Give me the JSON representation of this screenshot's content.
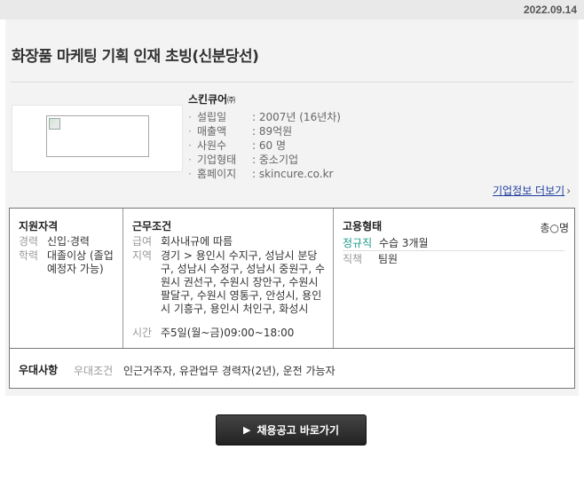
{
  "header": {
    "date": "2022.09.14"
  },
  "job": {
    "title": "화장품 마케팅 기획 인재 초빙(신분당선)"
  },
  "company": {
    "name": "스킨큐어",
    "name_suffix": "㈜",
    "info": [
      {
        "label": "설립일",
        "value": ": 2007년 (16년차)"
      },
      {
        "label": "매출액",
        "value": ": 89억원"
      },
      {
        "label": "사원수",
        "value": ": 60 명"
      },
      {
        "label": "기업형태",
        "value": ": 중소기업"
      },
      {
        "label": "홈페이지",
        "value": ": skincure.co.kr"
      }
    ],
    "more_link": "기업정보 더보기"
  },
  "qualification": {
    "title": "지원자격",
    "career_label": "경력",
    "career_value": "신입·경력",
    "education_label": "학력",
    "education_value": "대졸이상 (졸업예정자 가능)"
  },
  "work": {
    "title": "근무조건",
    "salary_label": "급여",
    "salary_value": "회사내규에 따름",
    "region_label": "지역",
    "region_value": "경기 > 용인시 수지구, 성남시 분당구, 성남시 수정구, 성남시 중원구, 수원시 권선구, 수원시 장안구, 수원시 팔달구, 수원시 영통구, 안성시, 용인시 기흥구, 용인시 처인구, 화성시",
    "hours_label": "시간",
    "hours_value": "주5일(월~금)09:00~18:00"
  },
  "employment": {
    "title": "고용형태",
    "head_count": "총○명",
    "type": "정규직",
    "probation": "수습 3개월",
    "position_label": "직책",
    "position_value": "팀원"
  },
  "preference": {
    "title": "우대사항",
    "label": "우대조건",
    "value": "인근거주자, 유관업무 경력자(2년), 운전 가능자"
  },
  "action": {
    "button_label": "채용공고 바로가기"
  }
}
